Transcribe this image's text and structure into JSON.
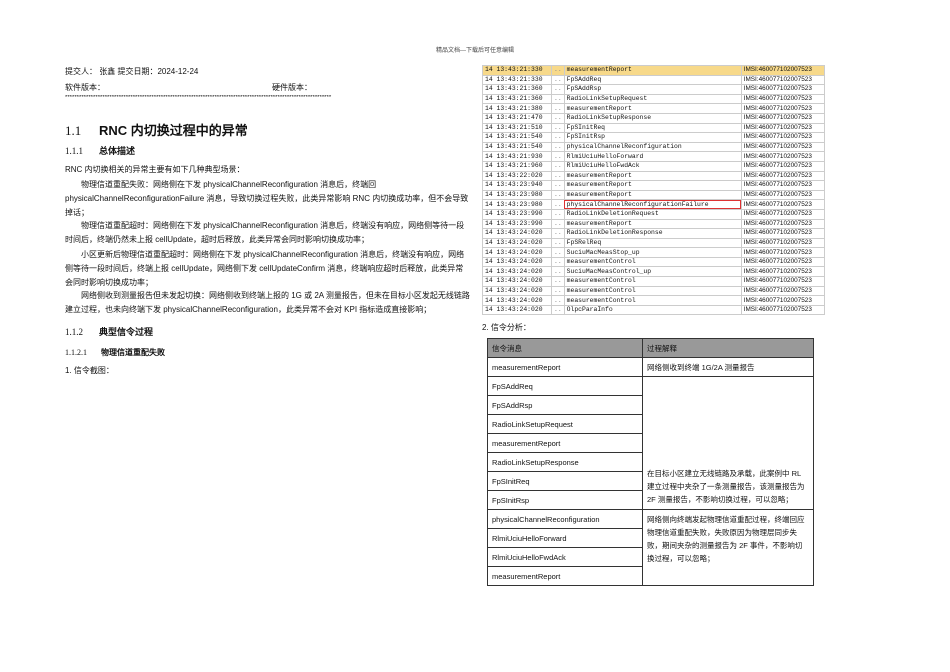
{
  "header": "精品文档---下载后可任意编辑",
  "submitter_line": "提交人：    张鑫  提交日期：2024-12-24",
  "software_label": "软件版本：",
  "hardware_label": "硬件版本：",
  "separator": "******************************************************************************************************************",
  "sec1": {
    "num": "1.1",
    "title": "RNC 内切换过程中的异常"
  },
  "sec11": {
    "num": "1.1.1",
    "title": "总体描述"
  },
  "intro": "RNC 内切换相关的异常主要有如下几种典型场景：",
  "paras": [
    "物理信道重配失败：网络侧在下发 physicalChannelReconfiguration 消息后，终端回 physicalChannelReconfigurationFailure 消息，导致切换过程失败，此类异常影响 RNC 内切换成功率，但不会导致掉话；",
    "物理信道重配超时：网络侧在下发 physicalChannelReconfiguration 消息后，终端没有响应，网络侧等待一段时间后，终端仍然未上报 cellUpdate，超时后释放，此类异常会同时影响切换成功率；",
    "小区更新后物理信道重配超时：网络侧在下发 physicalChannelReconfiguration 消息后，终端没有响应，网络侧等待一段时间后，终端上报 cellUpdate，网络侧下发 cellUpdateConfirm 消息，终端响应超时后释放，此类异常会同时影响切换成功率；",
    "网络侧收到测量报告但未发起切换：网络侧收到终端上报的 1G 或 2A 测量报告，但未在目标小区发起无线链路建立过程，也未向终端下发 physicalChannelReconfiguration，此类异常不会对 KPI 指标造成直接影响；"
  ],
  "sec112": {
    "num": "1.1.2",
    "title": "典型信令过程"
  },
  "sec1121": {
    "num": "1.1.2.1",
    "title": "物理信道重配失败"
  },
  "step1": "1. 信令截图：",
  "step2": "2. 信令分析：",
  "log": [
    [
      "14 13:43:21:330",
      "measurementReport",
      "IMSI:460077102007523"
    ],
    [
      "14 13:43:21:330",
      "FpSAddReq",
      "IMSI:460077102007523"
    ],
    [
      "14 13:43:21:360",
      "FpSAddRsp",
      "IMSI:460077102007523"
    ],
    [
      "14 13:43:21:360",
      "RadioLinkSetupRequest",
      "IMSI:460077102007523"
    ],
    [
      "14 13:43:21:380",
      "measurementReport",
      "IMSI:460077102007523"
    ],
    [
      "14 13:43:21:470",
      "RadioLinkSetupResponse",
      "IMSI:460077102007523"
    ],
    [
      "14 13:43:21:510",
      "FpSInitReq",
      "IMSI:460077102007523"
    ],
    [
      "14 13:43:21:540",
      "FpSInitRsp",
      "IMSI:460077102007523"
    ],
    [
      "14 13:43:21:540",
      "physicalChannelReconfiguration",
      "IMSI:460077102007523"
    ],
    [
      "14 13:43:21:930",
      "RlmiUciuHelloForward",
      "IMSI:460077102007523"
    ],
    [
      "14 13:43:21:960",
      "RlmiUciuHelloFwdAck",
      "IMSI:460077102007523"
    ],
    [
      "14 13:43:22:020",
      "measurementReport",
      "IMSI:460077102007523"
    ],
    [
      "14 13:43:23:940",
      "measurementReport",
      "IMSI:460077102007523"
    ],
    [
      "14 13:43:23:980",
      "measurementReport",
      "IMSI:460077102007523"
    ],
    [
      "14 13:43:23:980",
      "physicalChannelReconfigurationFailure",
      "IMSI:460077102007523"
    ],
    [
      "14 13:43:23:990",
      "RadioLinkDeletionRequest",
      "IMSI:460077102007523"
    ],
    [
      "14 13:43:23:990",
      "measurementReport",
      "IMSI:460077102007523"
    ],
    [
      "14 13:43:24:020",
      "RadioLinkDeletionResponse",
      "IMSI:460077102007523"
    ],
    [
      "14 13:43:24:020",
      "FpSRelReq",
      "IMSI:460077102007523"
    ],
    [
      "14 13:43:24:020",
      "SuciuMacMeasStop_up",
      "IMSI:460077102007523"
    ],
    [
      "14 13:43:24:020",
      "measurementControl",
      "IMSI:460077102007523"
    ],
    [
      "14 13:43:24:020",
      "SuciuMacMeasControl_up",
      "IMSI:460077102007523"
    ],
    [
      "14 13:43:24:020",
      "measurementControl",
      "IMSI:460077102007523"
    ],
    [
      "14 13:43:24:020",
      "measurementControl",
      "IMSI:460077102007523"
    ],
    [
      "14 13:43:24:020",
      "measurementControl",
      "IMSI:460077102007523"
    ],
    [
      "14 13:43:24:020",
      "OlpcParaInfo",
      "IMSI:460077102007523"
    ]
  ],
  "log_dots": "..",
  "sig_table": {
    "headers": [
      "信令消息",
      "过程解释"
    ],
    "messages": [
      "measurementReport",
      "FpSAddReq",
      "FpSAddRsp",
      "RadioLinkSetupRequest",
      "measurementReport",
      "RadioLinkSetupResponse",
      "FpSInitReq",
      "FpSInitRsp",
      "physicalChannelReconfiguration",
      "RlmiUciuHelloForward",
      "RlmiUciuHelloFwdAck",
      "measurementReport"
    ],
    "explanations": [
      "网络侧收到终端 1G/2A 测量报告",
      "在目标小区建立无线链路及承载，此案例中 RL 建立过程中夹杂了一条测量报告，该测量报告为 2F 测量报告，不影响切换过程，可以忽略；",
      "网络侧向终端发起物理信道重配过程，终端回应物理信道重配失败，失败原因为物理层同步失败，期间夹杂的测量报告为 2F 事件，不影响切换过程，可以忽略；"
    ]
  },
  "colors": {
    "selected_row": "#f7d98a",
    "highlight_box": "#dd3333",
    "table_header": "#999999"
  }
}
